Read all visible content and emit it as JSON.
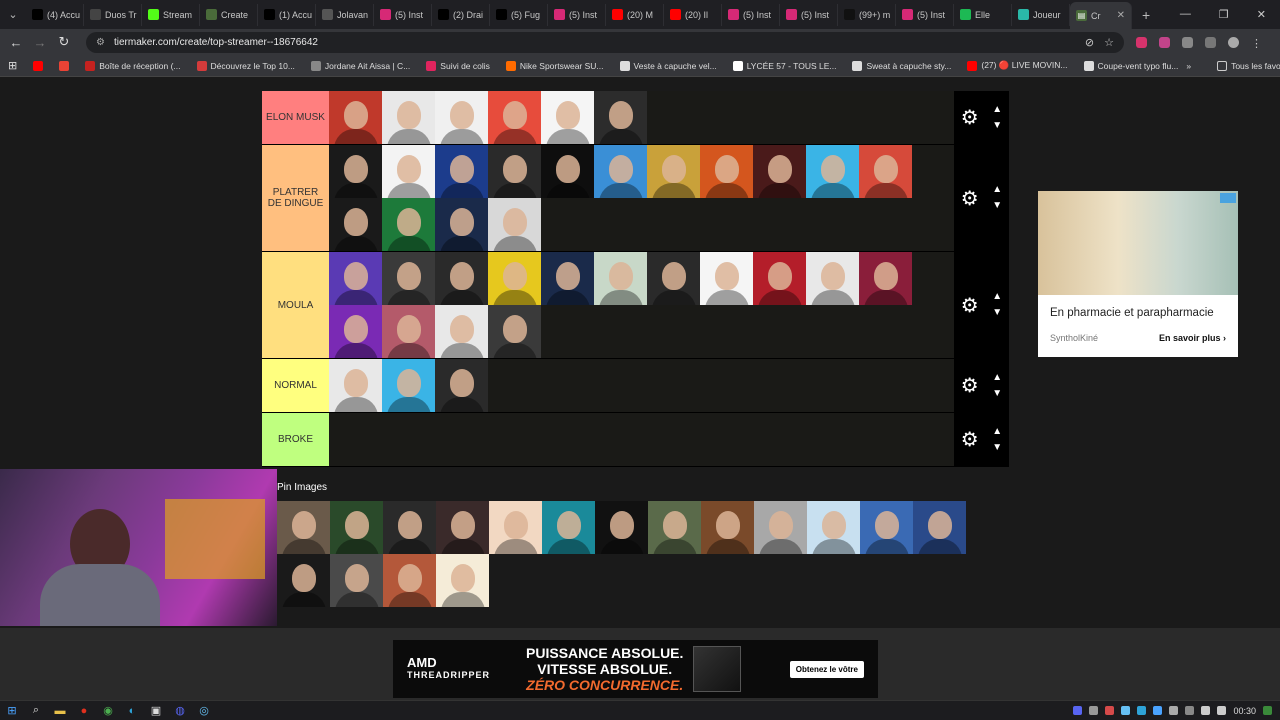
{
  "browser": {
    "tabs": [
      {
        "label": "(4) Accu",
        "icon": "x-icon",
        "color": "#000000"
      },
      {
        "label": "Duos Tr",
        "icon": "doc-icon",
        "color": "#444444"
      },
      {
        "label": "Stream",
        "icon": "k-icon",
        "color": "#53fc18"
      },
      {
        "label": "Create",
        "icon": "tiermaker-icon",
        "color": "#4a6b3a"
      },
      {
        "label": "(1) Accu",
        "icon": "x-icon",
        "color": "#000000"
      },
      {
        "label": "Jolavan",
        "icon": "doc-icon",
        "color": "#555555"
      },
      {
        "label": "(5) Inst",
        "icon": "instagram-icon",
        "color": "#d62976"
      },
      {
        "label": "(2) Drai",
        "icon": "x-icon",
        "color": "#000000"
      },
      {
        "label": "(5) Fug",
        "icon": "x-icon",
        "color": "#000000"
      },
      {
        "label": "(5) Inst",
        "icon": "instagram-icon",
        "color": "#d62976"
      },
      {
        "label": "(20) M",
        "icon": "youtube-icon",
        "color": "#ff0000"
      },
      {
        "label": "(20) Il",
        "icon": "youtube-icon",
        "color": "#ff0000"
      },
      {
        "label": "(5) Inst",
        "icon": "instagram-icon",
        "color": "#d62976"
      },
      {
        "label": "(5) Inst",
        "icon": "instagram-icon",
        "color": "#d62976"
      },
      {
        "label": "(99+) m",
        "icon": "tiktok-icon",
        "color": "#111111"
      },
      {
        "label": "(5) Inst",
        "icon": "instagram-icon",
        "color": "#d62976"
      },
      {
        "label": "Elle",
        "icon": "spotify-icon",
        "color": "#1db954"
      },
      {
        "label": "Joueur",
        "icon": "t-icon",
        "color": "#2ab8a8"
      }
    ],
    "active_tab": {
      "label": "Cr",
      "icon": "tiermaker-icon"
    },
    "new_tab": "+",
    "url": "tiermaker.com/create/top-streamer--18676642",
    "bookmarks": [
      {
        "label": "",
        "color": "#ff0000"
      },
      {
        "label": "",
        "color": "#ea4335"
      },
      {
        "label": "Boîte de réception (...",
        "color": "#c5221f"
      },
      {
        "label": "Découvrez le Top 10...",
        "color": "#d43b3b"
      },
      {
        "label": "Jordane Ait Aissa | C...",
        "color": "#888888"
      },
      {
        "label": "Suivi de colis",
        "color": "#e0245e"
      },
      {
        "label": "Nike Sportswear SU...",
        "color": "#ff6b00"
      },
      {
        "label": "Veste à capuche vel...",
        "color": "#dddddd"
      },
      {
        "label": "LYCÉE 57 - TOUS LE...",
        "color": "#ffffff"
      },
      {
        "label": "Sweat à capuche sty...",
        "color": "#dddddd"
      },
      {
        "label": "(27) 🔴 LIVE MOVIN...",
        "color": "#ff0000"
      },
      {
        "label": "Coupe-vent typo flu...",
        "color": "#dddddd"
      }
    ],
    "all_bookmarks": "Tous les favoris"
  },
  "tiers": [
    {
      "label": "ELON MUSK",
      "color": "#ff7f7f",
      "items": [
        "#c0392b",
        "#e8e8e8",
        "#f0f0f0",
        "#e74c3c",
        "#f5f5f5",
        "#2c2c2c"
      ]
    },
    {
      "label": "PLATRER DE DINGUE",
      "color": "#ffbf7f",
      "items": [
        "#1a1a1a",
        "#f3f3f3",
        "#1c3c8c",
        "#2a2a2a",
        "#0e0e0e",
        "#3a8fd6",
        "#c9a13a",
        "#d4561e",
        "#4a1a1a",
        "#3ab4e6",
        "#d64a3a",
        "#1a1a1a",
        "#1d7a3a",
        "#1a2a4a",
        "#d8d8d8"
      ]
    },
    {
      "label": "MOULA",
      "color": "#ffdf7f",
      "items": [
        "#5a3ab4",
        "#3a3a3a",
        "#2a2a2a",
        "#e6c81e",
        "#1a2a4a",
        "#c8d8c8",
        "#2a2a2a",
        "#f5f5f5",
        "#b41e2a",
        "#e8e8e8",
        "#8a1e3a",
        "#7a2ab4",
        "#b45a6a",
        "#e8e8e8",
        "#3a3a3a"
      ]
    },
    {
      "label": "NORMAL",
      "color": "#ffff7f",
      "items": [
        "#e8e8e8",
        "#3ab4e6",
        "#2a2a2a"
      ]
    },
    {
      "label": "BROKE",
      "color": "#bfff7f",
      "items": []
    }
  ],
  "pin_images": {
    "label": "Pin Images",
    "items": [
      "#6a5a4a",
      "#2a4a2a",
      "#2a2a2a",
      "#3a2a2a",
      "#f2d8c2",
      "#1a8a9a",
      "#111111",
      "#5a6a4a",
      "#7a4a2a",
      "#a8a8a8",
      "#c8e0f0",
      "#3a6ab4",
      "#2a4a8a",
      "#1a1a1a",
      "#4a4a4a",
      "#b4583a",
      "#f5ecd8"
    ]
  },
  "ad_right": {
    "title": "En pharmacie et parapharmacie",
    "brand": "SyntholKiné",
    "cta": "En savoir plus"
  },
  "ad_bottom": {
    "brand": "AMD",
    "product": "THREADRIPPER",
    "line1": "PUISSANCE ABSOLUE.",
    "line2": "VITESSE ABSOLUE.",
    "line3": "ZÉRO CONCURRENCE.",
    "cta": "Obtenez le vôtre"
  },
  "taskbar": {
    "time": "00:30"
  }
}
